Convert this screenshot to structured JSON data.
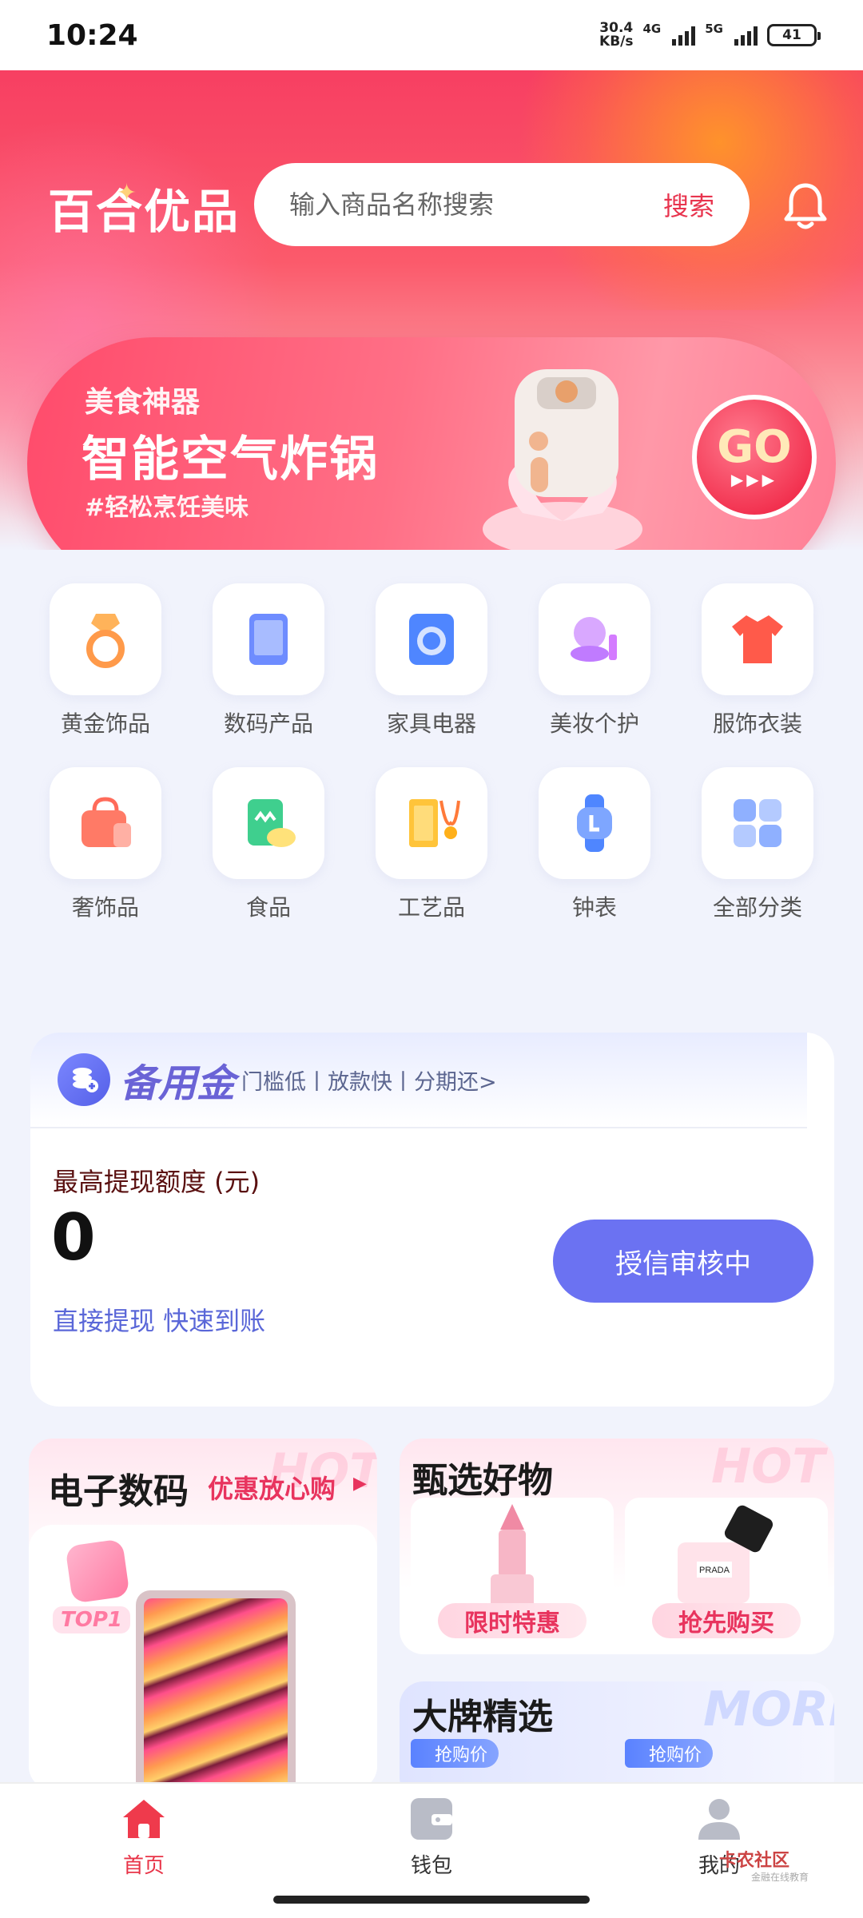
{
  "status_bar": {
    "time": "10:24",
    "net_speed_top": "30.4",
    "net_speed_bottom": "KB/s",
    "sig1": "4G",
    "sig2": "5G",
    "battery": "41"
  },
  "header": {
    "logo": "百合优品",
    "search_placeholder": "输入商品名称搜索",
    "search_button": "搜索",
    "bell_icon": "bell-icon"
  },
  "banner": {
    "subtitle": "美食神器",
    "title": "智能空气炸锅",
    "tagline": "#轻松烹饪美味",
    "go": "GO",
    "arrows": "▶▶▶"
  },
  "categories": [
    {
      "label": "黄金饰品",
      "icon": "ring-icon",
      "color": "#ff9a4a"
    },
    {
      "label": "数码产品",
      "icon": "tablet-icon",
      "color": "#6e8cff"
    },
    {
      "label": "家具电器",
      "icon": "washer-icon",
      "color": "#4f86ff"
    },
    {
      "label": "美妆个护",
      "icon": "cosmetics-icon",
      "color": "#c07bff"
    },
    {
      "label": "服饰衣装",
      "icon": "shirt-icon",
      "color": "#ff5a4a"
    },
    {
      "label": "奢饰品",
      "icon": "bag-icon",
      "color": "#ff6b5a"
    },
    {
      "label": "食品",
      "icon": "food-icon",
      "color": "#3fcf8e"
    },
    {
      "label": "工艺品",
      "icon": "gold-bar-icon",
      "color": "#ffc43a"
    },
    {
      "label": "钟表",
      "icon": "watch-icon",
      "color": "#4f86ff"
    },
    {
      "label": "全部分类",
      "icon": "grid-icon",
      "color": "#8fb0ff"
    }
  ],
  "fund": {
    "title": "备用金",
    "tags": "门槛低丨放款快丨分期还>",
    "label": "最高提现额度 (元)",
    "amount": "0",
    "link": "直接提现 快速到账",
    "button": "授信审核中"
  },
  "promo_left": {
    "title": "电子数码",
    "subtitle": "优惠放心购",
    "hot": "HOT",
    "top": "TOP1"
  },
  "promo_right": {
    "title": "甄选好物",
    "hot": "HOT",
    "card1_tag": "限时特惠",
    "card2_tag": "抢先购买",
    "perfume_brand": "PRADA"
  },
  "promo_right2": {
    "title": "大牌精选",
    "more": "MORE",
    "price_tag": "抢购价"
  },
  "bottom_nav": [
    {
      "label": "首页",
      "icon": "home-icon",
      "active": true
    },
    {
      "label": "钱包",
      "icon": "wallet-icon",
      "active": false
    },
    {
      "label": "我的",
      "icon": "user-icon",
      "active": false
    }
  ],
  "watermark": {
    "text": "卡农社区",
    "sub": "金融在线教育"
  }
}
